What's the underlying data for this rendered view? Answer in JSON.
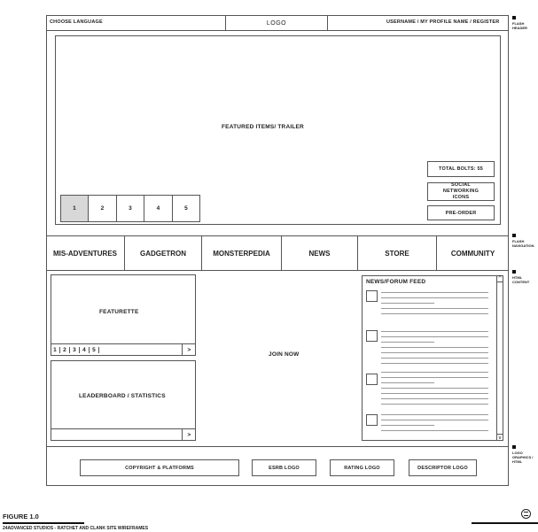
{
  "header": {
    "language": "CHOOSE LANGUAGE",
    "logo": "LOGO",
    "links": "USERNAME / MY PROFILE NAME / REGISTER"
  },
  "hero": {
    "title": "FEATURED ITEMS/ TRAILER",
    "pages": [
      "1",
      "2",
      "3",
      "4",
      "5"
    ],
    "total_bolts": "TOTAL BOLTS: 55",
    "social": "SOCIAL NETWORKING ICONS",
    "preorder": "PRE-ORDER"
  },
  "nav": {
    "items": [
      "MIS-ADVENTURES",
      "GADGETRON",
      "MONSTERPEDIA",
      "NEWS",
      "STORE",
      "COMMUNITY"
    ]
  },
  "content": {
    "featurette": "FEATURETTE",
    "featurette_pages": [
      "1",
      "2",
      "3",
      "4",
      "5"
    ],
    "arrow": ">",
    "leaderboard": "LEADERBOARD / STATISTICS",
    "join": "JOIN NOW",
    "news_title": "NEWS/FORUM FEED",
    "scroll_up": "^",
    "scroll_down": "v"
  },
  "footer": {
    "copyright": "COPYRIGHT & PLATFORMS",
    "esrb": "ESRB LOGO",
    "rating": "RATING LOGO",
    "descriptor": "DESCRIPTOR LOGO"
  },
  "notes": {
    "flash_header": "FLASH HEADER",
    "flash_nav": "FLASH NAVIGATION",
    "html_content": "HTML CONTENT",
    "logo_footer": "LOGO GRAPHICS / HTML"
  },
  "caption": {
    "figure": "FIGURE 1.0",
    "subtitle": "24ADVANCED STUDIOS - RATCHET AND CLANK SITE WIREFRAMES"
  }
}
